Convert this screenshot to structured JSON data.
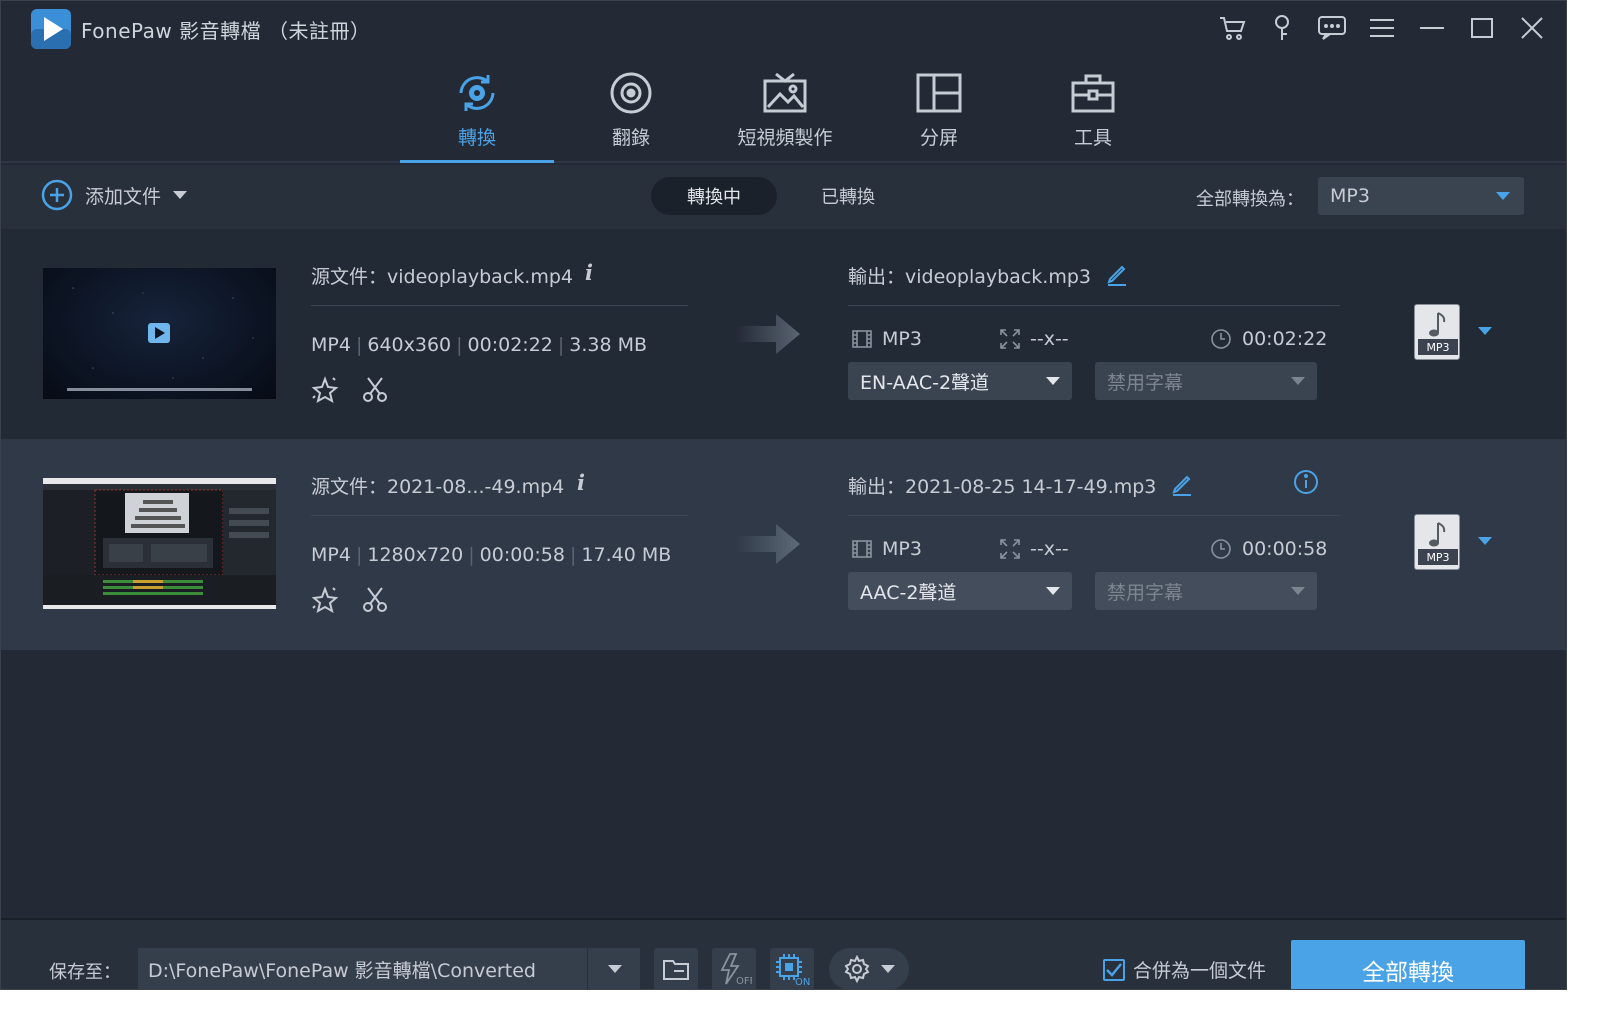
{
  "app": {
    "title": "FonePaw 影音轉檔 （未註冊）"
  },
  "nav": {
    "tabs": [
      {
        "label": "轉換",
        "active": true
      },
      {
        "label": "翻錄"
      },
      {
        "label": "短視頻製作"
      },
      {
        "label": "分屏"
      },
      {
        "label": "工具"
      }
    ]
  },
  "toolbar": {
    "add_file": "添加文件",
    "seg_converting": "轉換中",
    "seg_converted": "已轉換",
    "convert_all_to_label": "全部轉換為：",
    "convert_all_format": "MP3"
  },
  "files": [
    {
      "source": "源文件：videoplayback.mp4",
      "meta": {
        "format": "MP4",
        "resolution": "640x360",
        "duration": "00:02:22",
        "size": "3.38 MB"
      },
      "output": "輸出：videoplayback.mp3",
      "out_format": "MP3",
      "out_resolution": "--x--",
      "out_duration": "00:02:22",
      "audio_track": "EN-AAC-2聲道",
      "subtitle": "禁用字幕",
      "format_badge": "MP3"
    },
    {
      "source": "源文件：2021-08...-49.mp4",
      "meta": {
        "format": "MP4",
        "resolution": "1280x720",
        "duration": "00:00:58",
        "size": "17.40 MB"
      },
      "output": "輸出：2021-08-25 14-17-49.mp3",
      "out_format": "MP3",
      "out_resolution": "--x--",
      "out_duration": "00:00:58",
      "audio_track": "AAC-2聲道",
      "subtitle": "禁用字幕",
      "format_badge": "MP3"
    }
  ],
  "bottom": {
    "save_to_label": "保存至：",
    "save_path": "D:\\FonePaw\\FonePaw 影音轉檔\\Converted",
    "hw_off": "OFF",
    "hw_on": "ON",
    "merge_label": "合併為一個文件",
    "convert_all_button": "全部轉換"
  },
  "colors": {
    "accent": "#4aa3e6",
    "background": "#232a36",
    "row_alt": "#2f3948"
  }
}
